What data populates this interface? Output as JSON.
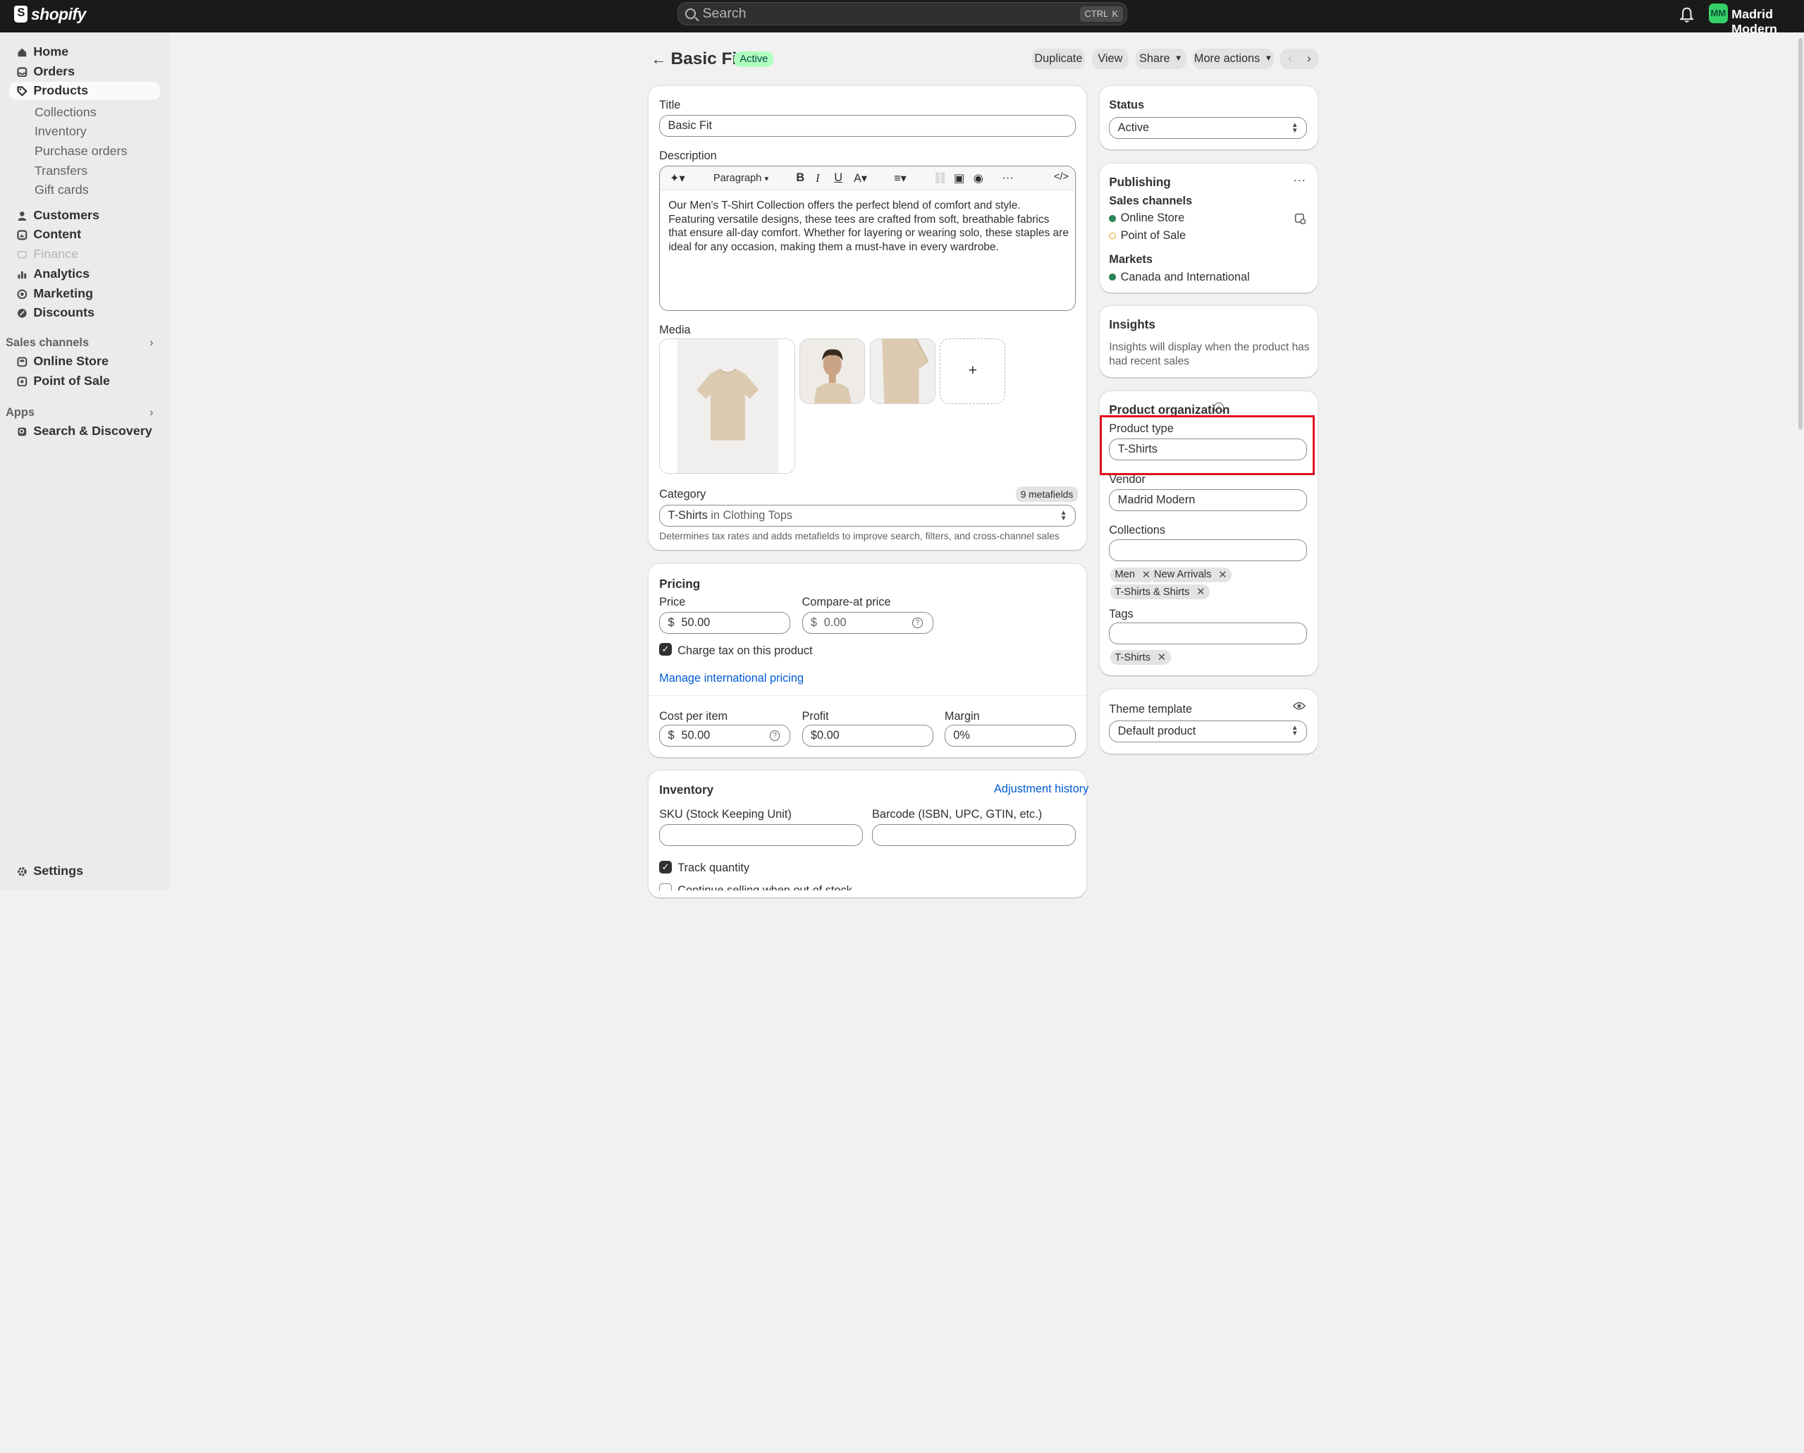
{
  "topbar": {
    "brand": "shopify",
    "search_placeholder": "Search",
    "shortcut_ctrl": "CTRL",
    "shortcut_k": "K",
    "avatar_initials": "MM",
    "store_name": "Madrid Modern",
    "avatar_color": "#36d068"
  },
  "sidebar": {
    "home": "Home",
    "orders": "Orders",
    "products": "Products",
    "collections": "Collections",
    "inventory": "Inventory",
    "purchase_orders": "Purchase orders",
    "transfers": "Transfers",
    "gift_cards": "Gift cards",
    "customers": "Customers",
    "content": "Content",
    "finance": "Finance",
    "analytics": "Analytics",
    "marketing": "Marketing",
    "discounts": "Discounts",
    "sales_channels_title": "Sales channels",
    "online_store": "Online Store",
    "point_of_sale": "Point of Sale",
    "apps_title": "Apps",
    "search_discovery": "Search & Discovery",
    "settings": "Settings"
  },
  "header": {
    "product_title": "Basic Fit",
    "status_badge": "Active",
    "duplicate": "Duplicate",
    "view": "View",
    "share": "Share",
    "more_actions": "More actions"
  },
  "details": {
    "title_label": "Title",
    "title_value": "Basic Fit",
    "description_label": "Description",
    "paragraph_format": "Paragraph",
    "description_text": "Our Men's T-Shirt Collection offers the perfect blend of comfort and style. Featuring versatile designs, these tees are crafted from soft, breathable fabrics that ensure all-day comfort. Whether for layering or wearing solo, these staples are ideal for any occasion, making them a must-have in every wardrobe.",
    "media_label": "Media",
    "add_media": "+",
    "category_label": "Category",
    "metafields_badge": "9 metafields",
    "category_value_bold": "T-Shirts",
    "category_value_rest": " in Clothing Tops",
    "category_help": "Determines tax rates and adds metafields to improve search, filters, and cross-channel sales"
  },
  "pricing": {
    "title": "Pricing",
    "price_label": "Price",
    "currency": "$",
    "price_value": "50.00",
    "compare_label": "Compare-at price",
    "compare_value": "0.00",
    "charge_tax": "Charge tax on this product",
    "manage_intl": "Manage international pricing",
    "cost_label": "Cost per item",
    "cost_value": "50.00",
    "profit_label": "Profit",
    "profit_value": "$0.00",
    "margin_label": "Margin",
    "margin_value": "0%"
  },
  "inventory": {
    "title": "Inventory",
    "adjustment_history": "Adjustment history",
    "sku_label": "SKU (Stock Keeping Unit)",
    "barcode_label": "Barcode (ISBN, UPC, GTIN, etc.)",
    "track_quantity": "Track quantity",
    "continue_selling": "Continue selling when out of stock"
  },
  "status_card": {
    "title": "Status",
    "value": "Active"
  },
  "publishing": {
    "title": "Publishing",
    "sales_channels": "Sales channels",
    "online_store": "Online Store",
    "point_of_sale": "Point of Sale",
    "markets": "Markets",
    "market_value": "Canada and International",
    "active_color": "#29845a",
    "inactive_color": "#e0a020"
  },
  "insights": {
    "title": "Insights",
    "text": "Insights will display when the product has had recent sales"
  },
  "organization": {
    "title": "Product organization",
    "product_type_label": "Product type",
    "product_type_value": "T-Shirts",
    "vendor_label": "Vendor",
    "vendor_value": "Madrid Modern",
    "collections_label": "Collections",
    "collection_tags": [
      "Men",
      "New Arrivals",
      "T-Shirts & Shirts"
    ],
    "tags_label": "Tags",
    "tags": [
      "T-Shirts"
    ],
    "highlight_color": "#e0101e"
  },
  "theme": {
    "title": "Theme template",
    "value": "Default product"
  }
}
